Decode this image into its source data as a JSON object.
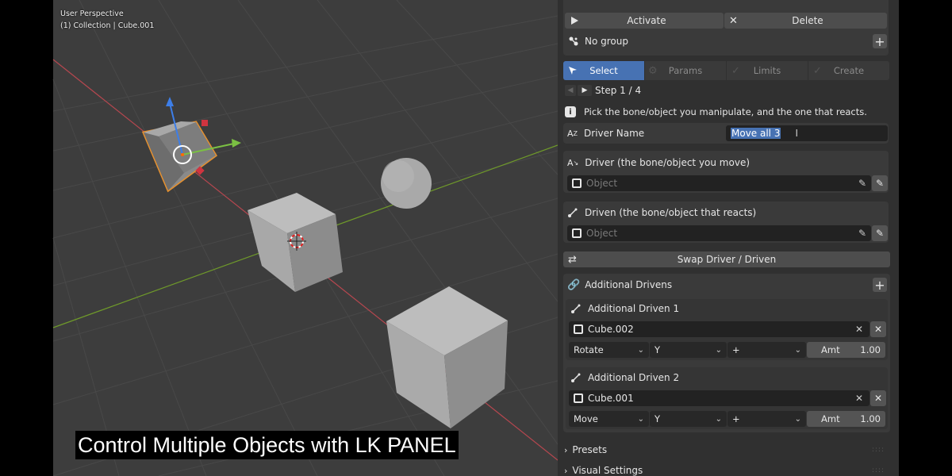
{
  "viewport": {
    "view_label": "User Perspective",
    "collection_label": "(1) Collection | Cube.001",
    "caption": "Control Multiple Objects with LK PANEL"
  },
  "toolbar": {
    "activate_label": "Activate",
    "delete_label": "Delete"
  },
  "group": {
    "label": "No group"
  },
  "tabs": [
    {
      "label": "Select",
      "active": true
    },
    {
      "label": "Params",
      "active": false
    },
    {
      "label": "Limits",
      "active": false
    },
    {
      "label": "Create",
      "active": false
    }
  ],
  "step": {
    "label": "Step 1 / 4"
  },
  "info": {
    "text": "Pick the bone/object you manipulate, and the one that reacts."
  },
  "driver_name": {
    "label": "Driver Name",
    "value": "Move all 3"
  },
  "driver": {
    "label": "Driver  (the bone/object you move)",
    "placeholder": "Object"
  },
  "driven": {
    "label": "Driven  (the bone/object that reacts)",
    "placeholder": "Object"
  },
  "swap": {
    "label": "Swap Driver / Driven"
  },
  "additional": {
    "label": "Additional Drivens",
    "items": [
      {
        "title": "Additional Driven 1",
        "object": "Cube.002",
        "mode": "Rotate",
        "axis": "Y",
        "sign": "+",
        "amt_label": "Amt",
        "amt_value": "1.00"
      },
      {
        "title": "Additional Driven 2",
        "object": "Cube.001",
        "mode": "Move",
        "axis": "Y",
        "sign": "+",
        "amt_label": "Amt",
        "amt_value": "1.00"
      }
    ]
  },
  "collapsed": {
    "presets": "Presets",
    "visual_settings": "Visual Settings"
  },
  "colors": {
    "accent": "#4772b3",
    "viewport_bg": "#3d3d3d",
    "panel_bg": "#303030",
    "selection_outline": "#e8912d"
  }
}
